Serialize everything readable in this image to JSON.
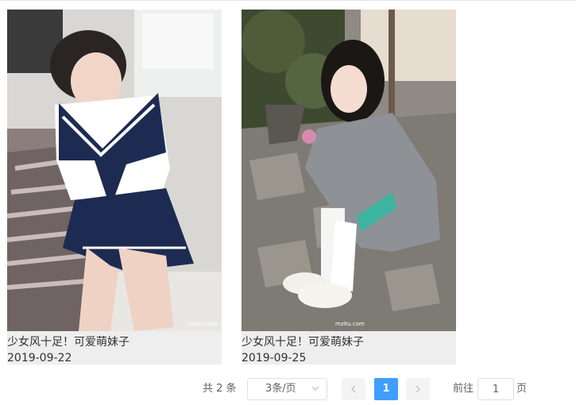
{
  "gallery": {
    "items": [
      {
        "title": "少女风十足！可爱萌妹子",
        "date": "2019-09-22",
        "watermark": "mzitu.com"
      },
      {
        "title": "少女风十足！可爱萌妹子",
        "date": "2019-09-25",
        "watermark": "mzitu.com"
      }
    ]
  },
  "pagination": {
    "total_text": "共 2 条",
    "page_size_value": "3条/页",
    "current_page": "1",
    "goto_prefix": "前往",
    "goto_value": "1",
    "goto_suffix": "页"
  },
  "colors": {
    "accent": "#409eff",
    "card_bg": "#eeeeee",
    "button_bg": "#f4f4f5",
    "border": "#dcdfe6"
  },
  "icons": {
    "prev": "chevron-left-icon",
    "next": "chevron-right-icon",
    "select": "chevron-down-icon"
  }
}
